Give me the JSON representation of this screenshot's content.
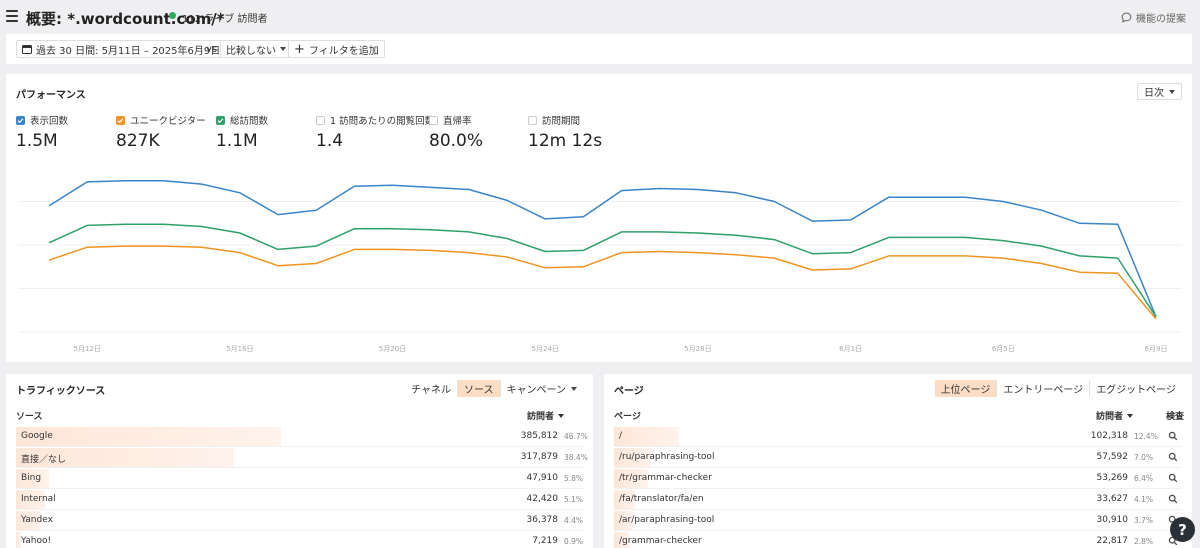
{
  "header": {
    "title": "概要: *.wordcount.com/*",
    "live_text": "112 ライブ 訪問者",
    "feedback": "機能の提案"
  },
  "filters": {
    "date_range": "過去 30 日間: 5月11日 – 2025年6月9日",
    "vs": "vs",
    "compare": "比較しない",
    "add_filter": "フィルタを追加"
  },
  "performance": {
    "title": "パフォーマンス",
    "interval": "日次",
    "metrics": [
      {
        "label": "表示回数",
        "value": "1.5M",
        "checked": true,
        "color": "#3a84c9"
      },
      {
        "label": "ユニークビジター",
        "value": "827K",
        "checked": true,
        "color": "#f0941f"
      },
      {
        "label": "総訪問数",
        "value": "1.1M",
        "checked": true,
        "color": "#2fa06a"
      },
      {
        "label": "1 訪問あたりの閲覧回数",
        "value": "1.4",
        "checked": false,
        "color": ""
      },
      {
        "label": "直帰率",
        "value": "80.0%",
        "checked": false,
        "color": ""
      },
      {
        "label": "訪問期間",
        "value": "12m 12s",
        "checked": false,
        "color": ""
      }
    ]
  },
  "chart_data": {
    "type": "line",
    "x": [
      "5月11日",
      "5月12日",
      "5月13日",
      "5月14日",
      "5月15日",
      "5月16日",
      "5月17日",
      "5月18日",
      "5月19日",
      "5月20日",
      "5月21日",
      "5月22日",
      "5月23日",
      "5月24日",
      "5月25日",
      "5月26日",
      "5月27日",
      "5月28日",
      "5月29日",
      "5月30日",
      "5月31日",
      "6月1日",
      "6月2日",
      "6月3日",
      "6月4日",
      "6月5日",
      "6月6日",
      "6月7日",
      "6月8日",
      "6月9日"
    ],
    "x_tick_labels": [
      "5月12日",
      "5月16日",
      "5月20日",
      "5月24日",
      "5月28日",
      "6月1日",
      "6月5日",
      "6月9日"
    ],
    "series": [
      {
        "name": "表示回数",
        "color": "#3a84c9",
        "values": [
          58,
          69,
          69.5,
          69.5,
          68,
          64,
          54,
          56,
          67,
          67.5,
          66.5,
          65.5,
          60.5,
          52,
          53,
          65,
          66,
          65.5,
          64,
          60,
          51,
          51.5,
          62,
          62,
          62,
          60,
          56,
          50,
          49.5,
          7
        ]
      },
      {
        "name": "総訪問数",
        "color": "#2fa06a",
        "values": [
          41,
          49,
          49.5,
          49.5,
          48.5,
          45.5,
          38,
          39.5,
          47.5,
          47.5,
          47,
          46,
          43,
          37,
          37.5,
          46,
          46,
          45.5,
          44.5,
          42.5,
          36,
          36.5,
          43.5,
          43.5,
          43.5,
          42,
          39.5,
          35,
          34,
          7
        ]
      },
      {
        "name": "ユニークビジター",
        "color": "#f0941f",
        "values": [
          33,
          39,
          39.5,
          39.5,
          39,
          36.5,
          30.5,
          31.5,
          38,
          38,
          37.5,
          36.5,
          34.5,
          29.5,
          30,
          36.5,
          37,
          36.5,
          35.5,
          34,
          28.5,
          29,
          35,
          35,
          35,
          34,
          31.5,
          27.5,
          27,
          6
        ]
      }
    ]
  },
  "traffic": {
    "title": "トラフィックソース",
    "tabs": [
      "チャネル",
      "ソース",
      "キャンペーン"
    ],
    "active_tab": 1,
    "col_name": "ソース",
    "col_visitors": "訪問者",
    "rows": [
      {
        "name": "Google",
        "value": "385,812",
        "pct": "46.7%",
        "share": 0.467
      },
      {
        "name": "直接／なし",
        "value": "317,879",
        "pct": "38.4%",
        "share": 0.384
      },
      {
        "name": "Bing",
        "value": "47,910",
        "pct": "5.8%",
        "share": 0.058
      },
      {
        "name": "Internal",
        "value": "42,420",
        "pct": "5.1%",
        "share": 0.051
      },
      {
        "name": "Yandex",
        "value": "36,378",
        "pct": "4.4%",
        "share": 0.044
      },
      {
        "name": "Yahoo!",
        "value": "7,219",
        "pct": "0.9%",
        "share": 0.009
      }
    ]
  },
  "pages": {
    "title": "ページ",
    "tabs": [
      "上位ページ",
      "エントリーページ",
      "エグジットページ"
    ],
    "active_tab": 0,
    "col_name": "ページ",
    "col_visitors": "訪問者",
    "col_inspect": "検査",
    "rows": [
      {
        "name": "/",
        "value": "102,318",
        "pct": "12.4%",
        "share": 0.124
      },
      {
        "name": "/ru/paraphrasing-tool",
        "value": "57,592",
        "pct": "7.0%",
        "share": 0.07
      },
      {
        "name": "/tr/grammar-checker",
        "value": "53,269",
        "pct": "6.4%",
        "share": 0.064
      },
      {
        "name": "/fa/translator/fa/en",
        "value": "33,627",
        "pct": "4.1%",
        "share": 0.041
      },
      {
        "name": "/ar/paraphrasing-tool",
        "value": "30,910",
        "pct": "3.7%",
        "share": 0.037
      },
      {
        "name": "/grammar-checker",
        "value": "22,817",
        "pct": "2.8%",
        "share": 0.028
      }
    ]
  },
  "help_label": "?"
}
